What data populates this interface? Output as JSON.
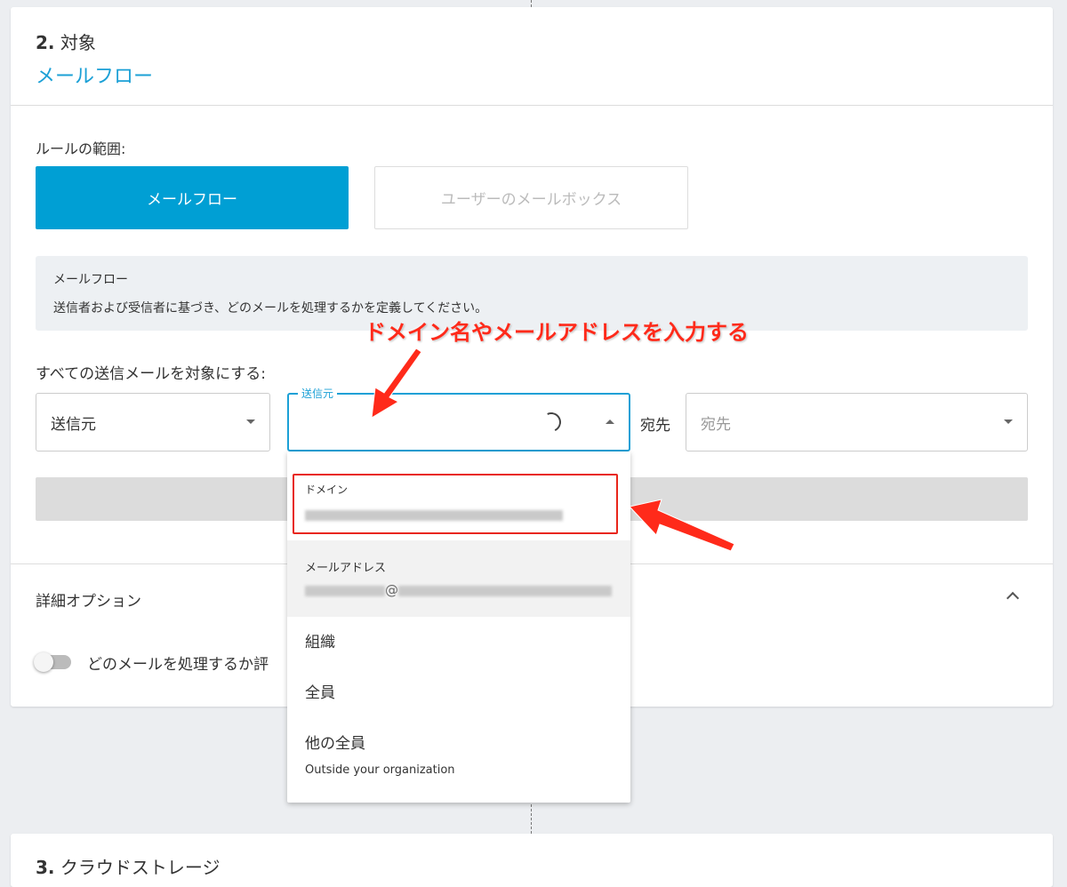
{
  "section2": {
    "number": "2.",
    "title": "対象",
    "subtitle": "メールフロー"
  },
  "scope": {
    "label": "ルールの範囲:",
    "options": [
      "メールフロー",
      "ユーザーのメールボックス"
    ]
  },
  "info": {
    "title": "メールフロー",
    "text": "送信者および受信者に基づき、どのメールを処理するかを定義してください。"
  },
  "target": {
    "label": "すべての送信メールを対象にする:",
    "select1": "送信元",
    "field_label": "送信元",
    "to_label": "宛先",
    "to_placeholder": "宛先"
  },
  "dropdown": {
    "items": [
      {
        "label": "ドメイン"
      },
      {
        "label": "メールアドレス",
        "at": "@"
      },
      {
        "label": "組織"
      },
      {
        "label": "全員"
      },
      {
        "label": "他の全員",
        "sub": "Outside your organization"
      }
    ]
  },
  "advanced": {
    "title": "詳細オプション",
    "toggle_label": "どのメールを処理するか評"
  },
  "annotation": {
    "text": "ドメイン名やメールアドレスを入力する",
    "color": "#ff2a1a"
  },
  "section3": {
    "number": "3.",
    "title": "クラウドストレージ"
  },
  "colors": {
    "accent": "#009fd4"
  }
}
